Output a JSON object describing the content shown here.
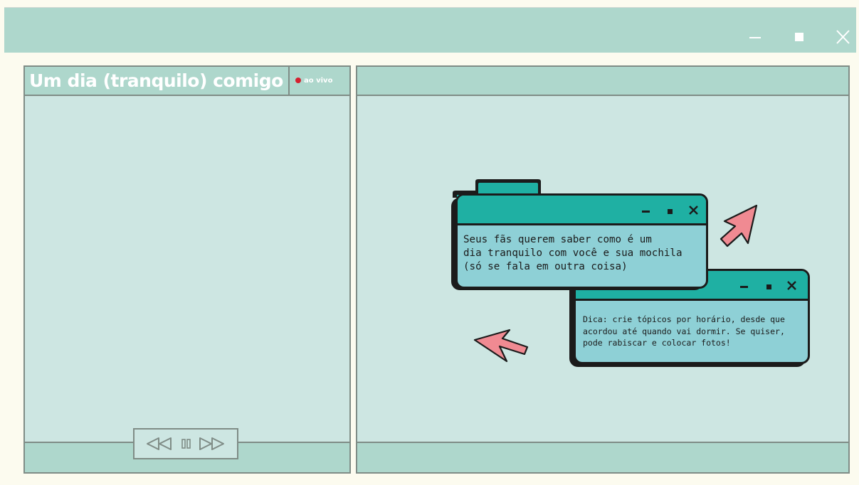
{
  "window": {
    "controls": [
      "minimize-icon",
      "maximize-icon",
      "close-icon"
    ]
  },
  "left_panel": {
    "title": "Um dia (tranquilo) comigo",
    "live_label": "ao vivo",
    "player_icons": [
      "rewind-icon",
      "pause-icon",
      "fast-forward-icon"
    ]
  },
  "right_panel": {
    "popup_main": {
      "text": "Seus fãs querem saber como é um\ndia tranquilo com você e sua mochila\n(só se fala em outra coisa)"
    },
    "popup_tip": {
      "text": "Dica: crie tópicos por horário, desde que\nacordou até quando vai dormir. Se quiser,\npode rabiscar e colocar fotos!"
    },
    "decorations": [
      "arrow-cursor-icon",
      "arrow-cursor-icon"
    ]
  },
  "colors": {
    "background": "#fcfbef",
    "chrome": "#aed7cc",
    "panel": "#cde6e2",
    "border": "#7f8c86",
    "popup_bar": "#1fb0a3",
    "popup_body": "#8ed0d6",
    "cursor_pink": "#f08a92",
    "live_dot": "#d5212f"
  }
}
